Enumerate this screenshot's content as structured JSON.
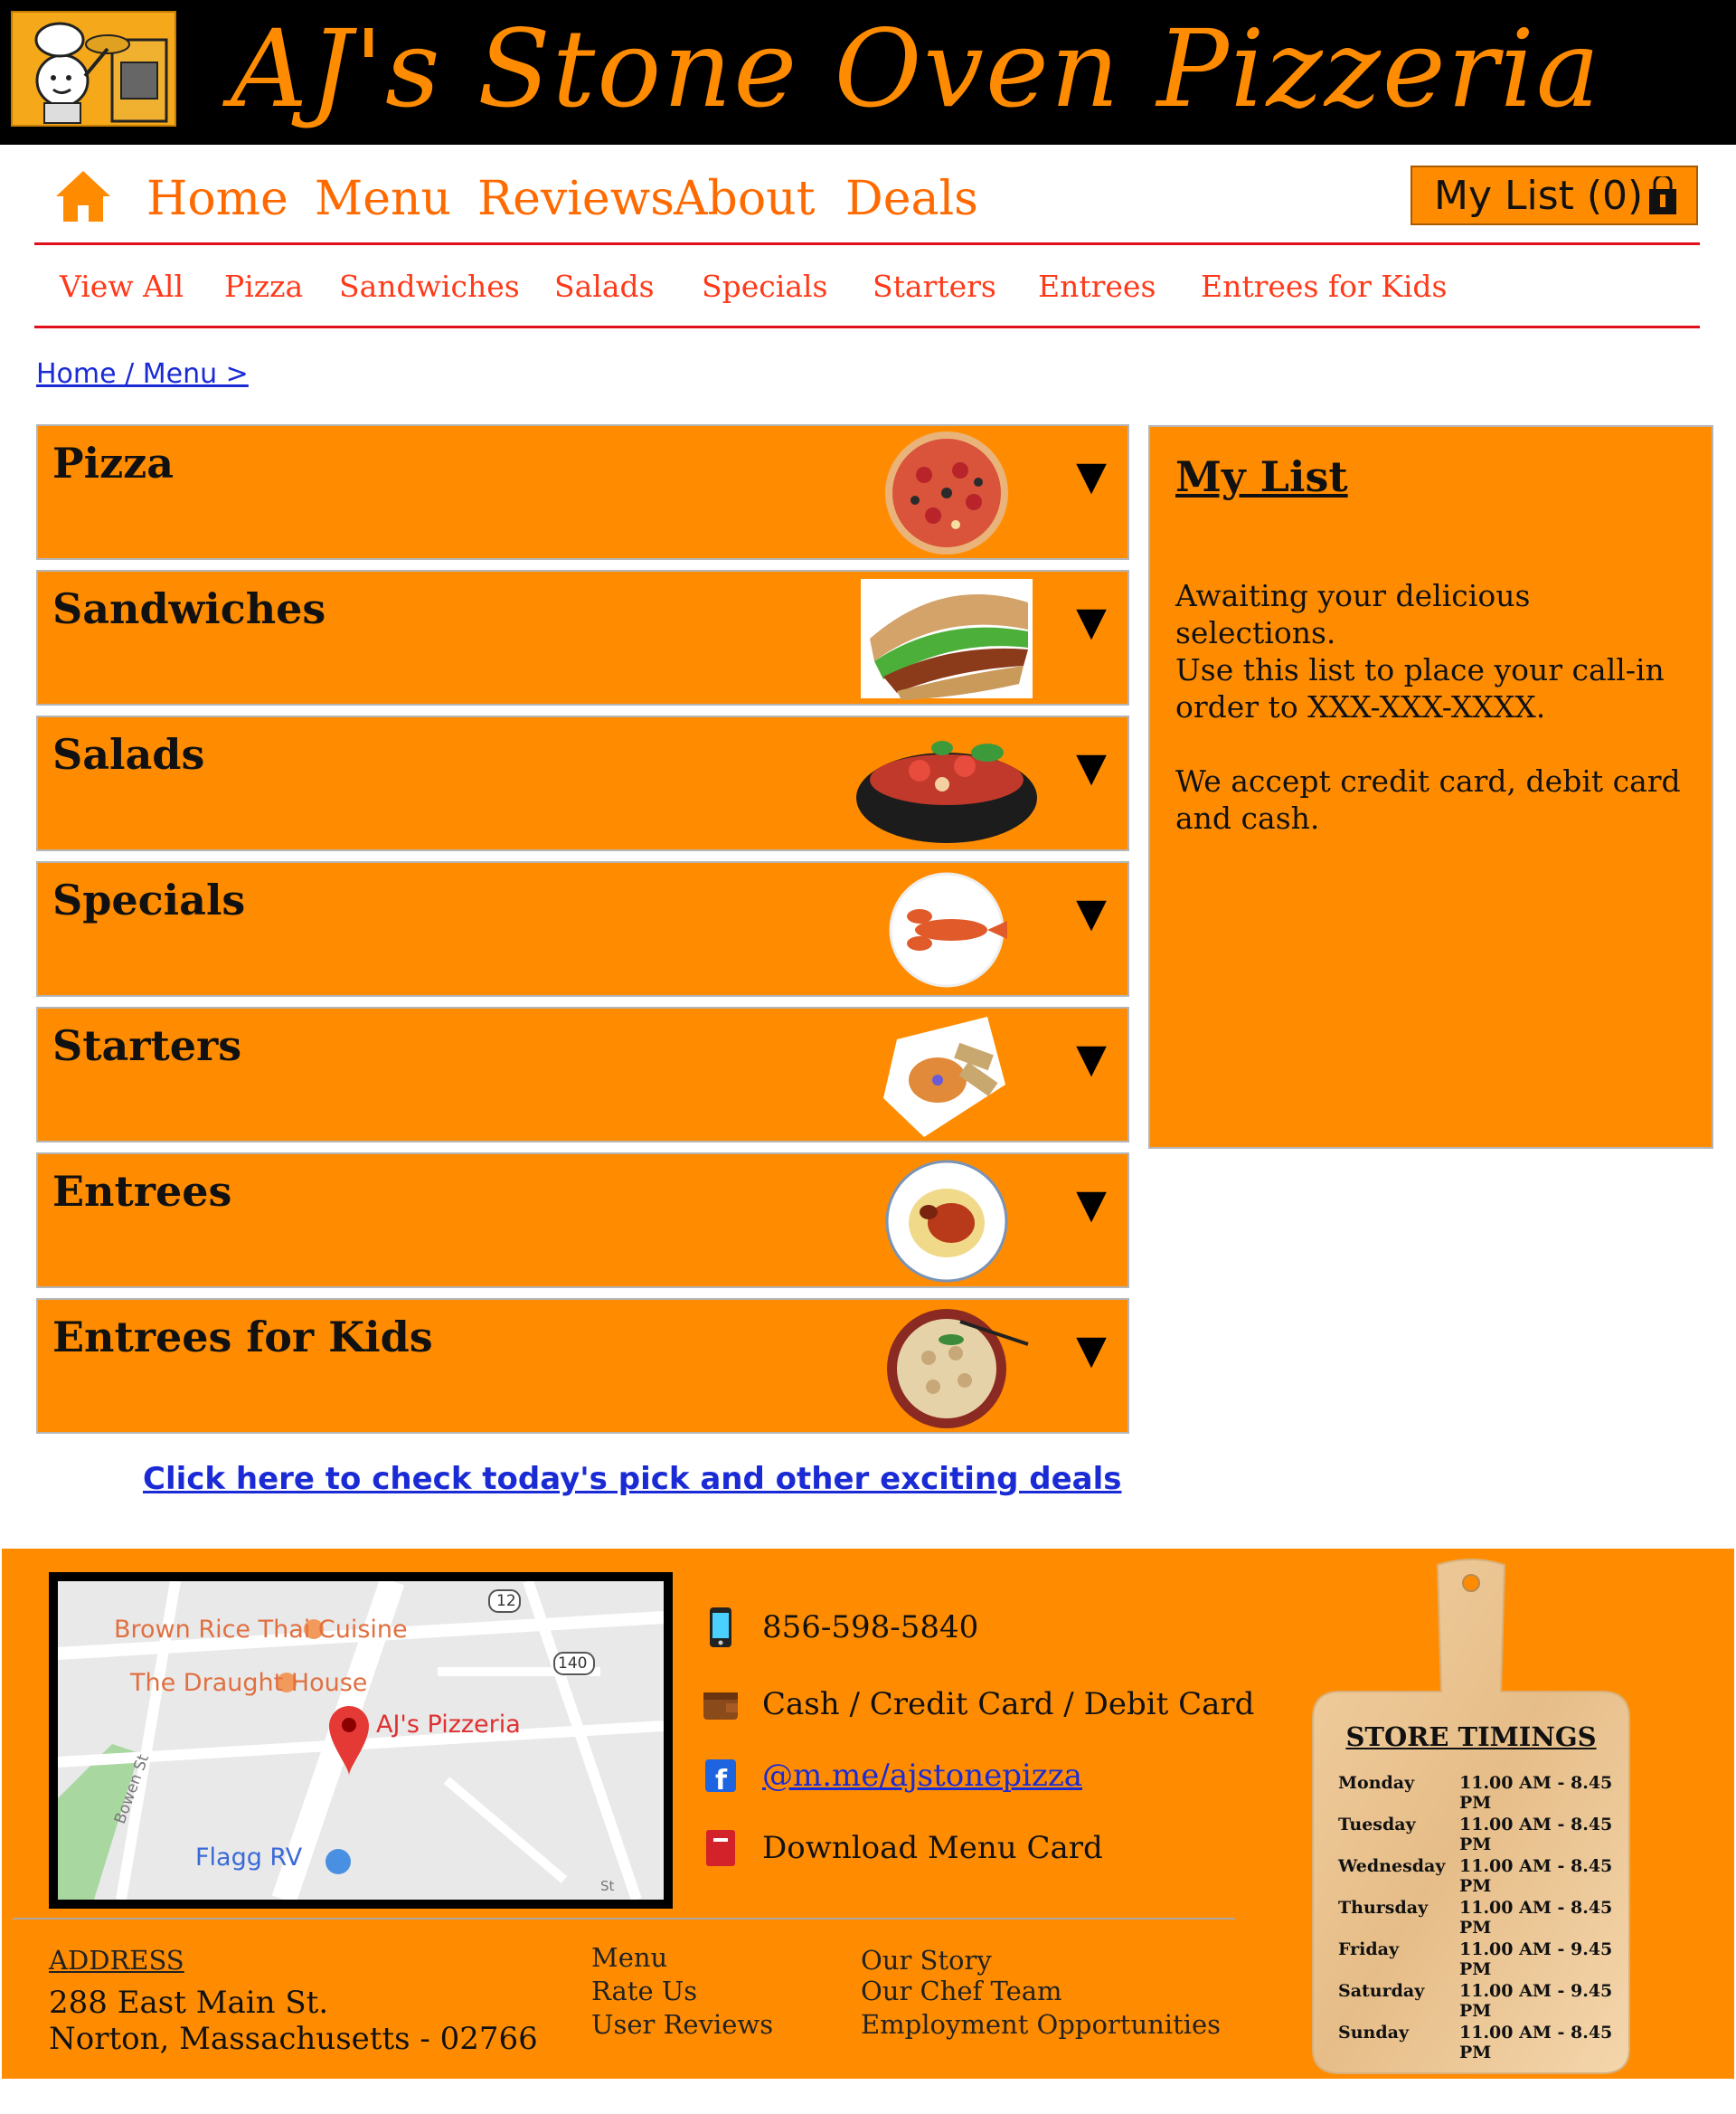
{
  "header": {
    "title": "AJ's Stone Oven Pizzeria"
  },
  "nav": {
    "items": [
      "Home",
      "Menu",
      "Reviews",
      "About",
      "Deals"
    ],
    "my_list": "My List (0)"
  },
  "subnav": [
    "View All",
    "Pizza",
    "Sandwiches",
    "Salads",
    "Specials",
    "Starters",
    "Entrees",
    "Entrees for Kids"
  ],
  "breadcrumb": "Home / Menu >",
  "categories": [
    {
      "name": "Pizza",
      "icon": "pizza-image"
    },
    {
      "name": "Sandwiches",
      "icon": "sandwich-image"
    },
    {
      "name": "Salads",
      "icon": "salad-image"
    },
    {
      "name": "Specials",
      "icon": "lobster-image"
    },
    {
      "name": "Starters",
      "icon": "starter-plate-image"
    },
    {
      "name": "Entrees",
      "icon": "spaghetti-image"
    },
    {
      "name": "Entrees for Kids",
      "icon": "kids-bowl-image"
    }
  ],
  "arrow": "▼",
  "my_list_panel": {
    "title": "My List",
    "line1": "Awaiting your delicious selections.",
    "line2": "Use this list to place your call-in order to XXX-XXX-XXXX.",
    "line3": "We accept credit card, debit card and cash."
  },
  "deals_link": "Click here to check today's pick and other exciting deals",
  "footer": {
    "map_labels": {
      "brown_rice": "Brown Rice Thai Cuisine",
      "draught": "The Draught House",
      "pizzeria": "AJ's Pizzeria",
      "flagg": "Flagg RV",
      "bowen": "Bowen St",
      "route12": "12",
      "route140": "140",
      "st": "St"
    },
    "phone": "856-598-5840",
    "payment": "Cash / Credit Card / Debit Card",
    "facebook": "@m.me/ajstonepizza",
    "download": "Download Menu Card",
    "address_heading": "ADDRESS",
    "address_line1": "288 East Main St.",
    "address_line2": "Norton, Massachusetts - 02766",
    "links_col1": [
      "Menu",
      "Rate Us",
      "User Reviews"
    ],
    "links_col2": [
      "Our Story",
      "Our Chef Team",
      "Employment Opportunities"
    ],
    "timings": {
      "title": "STORE TIMINGS",
      "rows": [
        {
          "day": "Monday",
          "time": "11.00 AM - 8.45 PM"
        },
        {
          "day": "Tuesday",
          "time": "11.00 AM - 8.45 PM"
        },
        {
          "day": "Wednesday",
          "time": "11.00 AM - 8.45 PM"
        },
        {
          "day": "Thursday",
          "time": "11.00 AM - 8.45 PM"
        },
        {
          "day": "Friday",
          "time": "11.00 AM - 9.45 PM"
        },
        {
          "day": "Saturday",
          "time": "11.00 AM - 9.45 PM"
        },
        {
          "day": "Sunday",
          "time": "11.00 AM - 8.45 PM"
        }
      ]
    }
  },
  "colors": {
    "accent": "#ff8c00",
    "nav_text": "#ff6a00",
    "divider": "#e0101a",
    "link": "#1a2bd6"
  }
}
